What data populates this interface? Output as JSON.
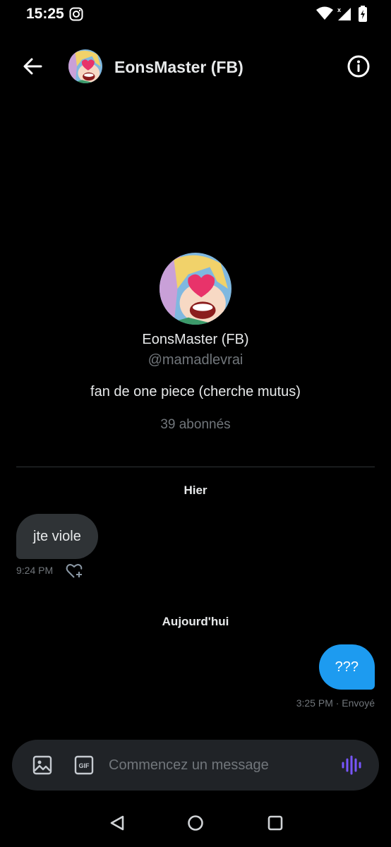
{
  "status_bar": {
    "time": "15:25",
    "icons": [
      "instagram-icon",
      "wifi-icon",
      "signal-icon",
      "battery-icon"
    ]
  },
  "header": {
    "title": "EonsMaster (FB)",
    "icons": [
      "back-arrow-icon",
      "info-icon"
    ]
  },
  "profile": {
    "name": "EonsMaster (FB)",
    "handle": "@mamadlevrai",
    "bio": "fan de one piece (cherche mutus)",
    "followers": "39 abonnés"
  },
  "conversation": {
    "days": [
      {
        "label": "Hier",
        "messages": [
          {
            "direction": "received",
            "text": "jte viole",
            "meta": "9:24 PM"
          }
        ]
      },
      {
        "label": "Aujourd'hui",
        "messages": [
          {
            "direction": "sent",
            "text": "???",
            "meta": "3:25 PM · Envoyé"
          }
        ]
      }
    ]
  },
  "composer": {
    "placeholder": "Commencez un message",
    "gif_label": "GIF",
    "icons": [
      "image-icon",
      "gif-icon",
      "voice-message-icon"
    ]
  },
  "colors": {
    "background": "#000000",
    "accent": "#1d9bf0",
    "received_bubble": "#2f3336",
    "muted_text": "#71767b",
    "voice_icon": "#7856ff"
  }
}
